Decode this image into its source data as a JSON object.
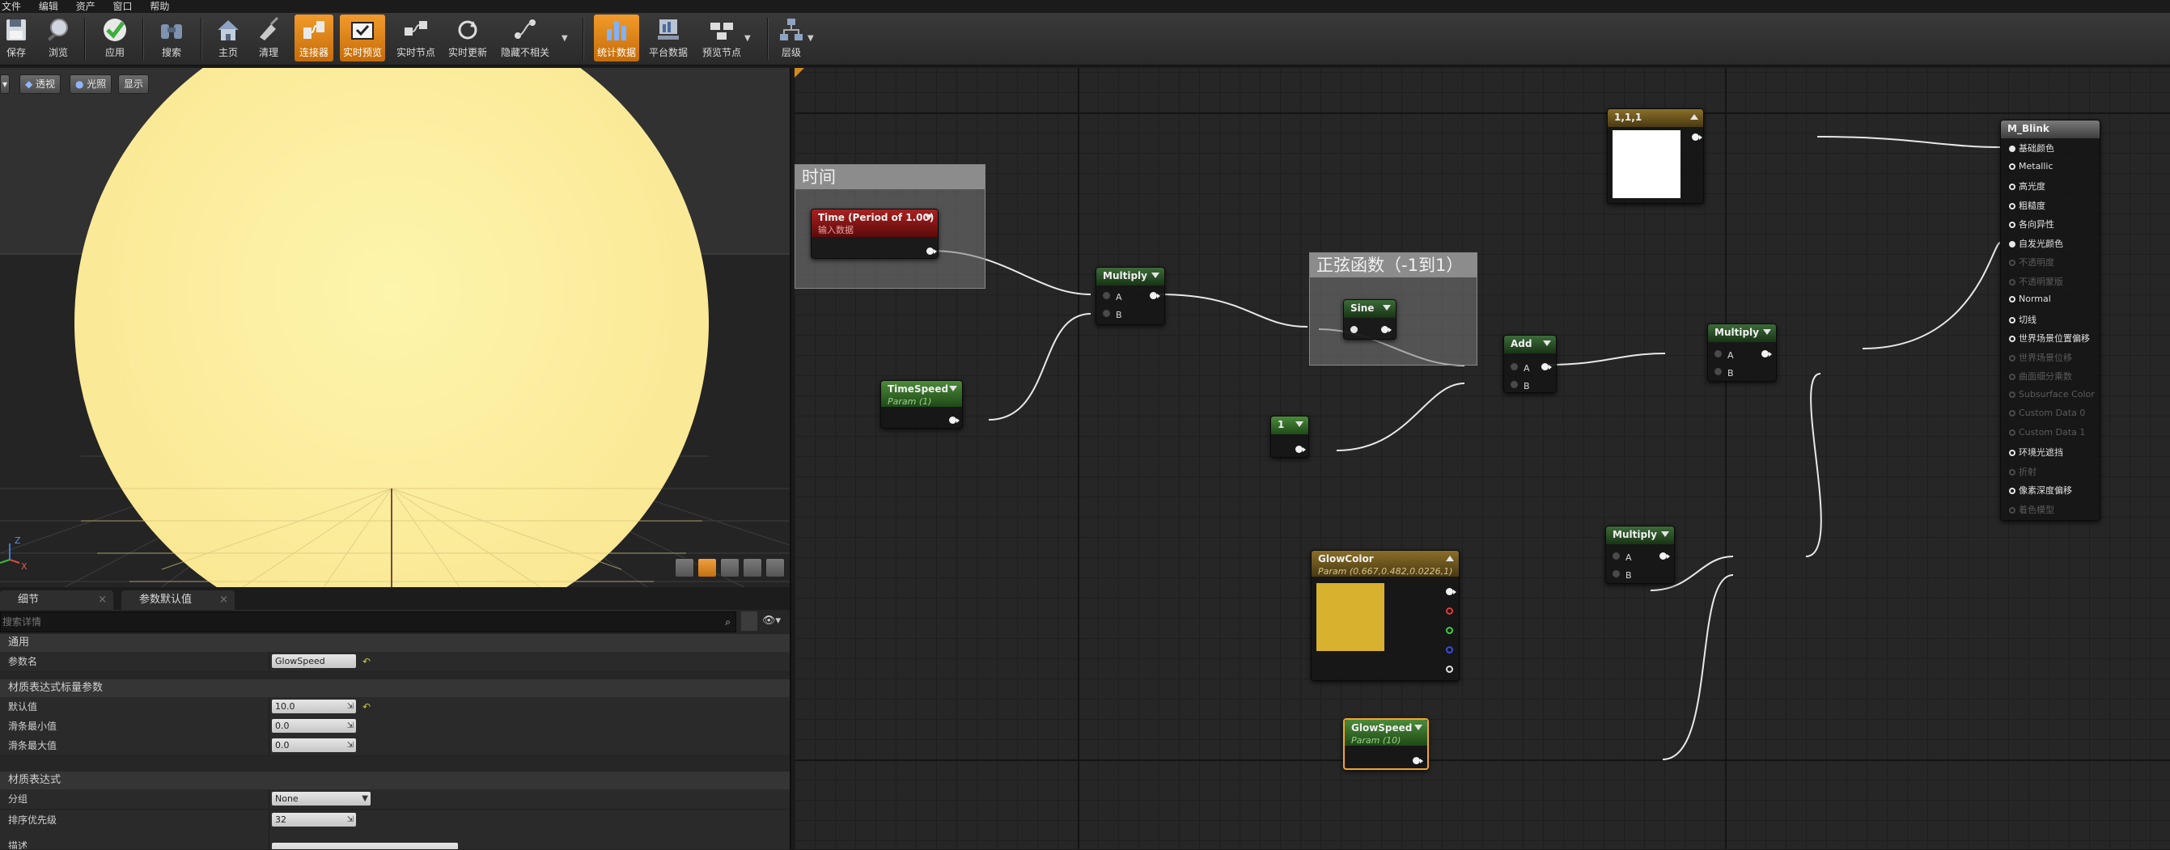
{
  "menu": [
    "文件",
    "编辑",
    "资产",
    "窗口",
    "帮助"
  ],
  "toolbar": {
    "buttons": [
      "保存",
      "浏览",
      "应用",
      "搜索",
      "主页",
      "清理",
      "连接器",
      "实时预览",
      "实时节点",
      "实时更新",
      "隐藏不相关",
      "统计数据",
      "平台数据",
      "预览节点",
      "层级"
    ],
    "active": [
      "连接器",
      "实时预览",
      "统计数据"
    ]
  },
  "viewport": {
    "buttons": [
      "透视",
      "光照",
      "显示"
    ],
    "axis": {
      "z": "Z",
      "x": "X"
    }
  },
  "details": {
    "tabs": [
      "细节",
      "参数默认值"
    ],
    "search_placeholder": "搜索详情",
    "categories": {
      "general": "通用",
      "scalar": "材质表达式标量参数",
      "expression": "材质表达式"
    },
    "props": {
      "param_name": {
        "label": "参数名",
        "value": "GlowSpeed"
      },
      "default": {
        "label": "默认值",
        "value": "10.0"
      },
      "slider_min": {
        "label": "滑条最小值",
        "value": "0.0"
      },
      "slider_max": {
        "label": "滑条最大值",
        "value": "0.0"
      },
      "group": {
        "label": "分组",
        "value": "None"
      },
      "sort": {
        "label": "排序优先级",
        "value": "32"
      },
      "desc": {
        "label": "描述"
      }
    }
  },
  "graph": {
    "comments": {
      "time": "时间",
      "sine": "正弦函数（-1到1）"
    },
    "nodes": {
      "time": {
        "title": "Time (Period of 1.00)",
        "sub": "输入数据"
      },
      "timespeed": {
        "title": "TimeSpeed",
        "sub": "Param (1)"
      },
      "multiply1": {
        "title": "Multiply"
      },
      "sine": {
        "title": "Sine"
      },
      "add": {
        "title": "Add"
      },
      "one": {
        "title": "1"
      },
      "multiply2": {
        "title": "Multiply"
      },
      "multiply3": {
        "title": "Multiply"
      },
      "glowcolor": {
        "title": "GlowColor",
        "sub": "Param (0.667,0.482,0.0226,1)",
        "swatch": "#d8b22f"
      },
      "glowspeed": {
        "title": "GlowSpeed",
        "sub": "Param (10)"
      },
      "white": {
        "title": "1,1,1"
      }
    },
    "pins": {
      "a": "A",
      "b": "B"
    },
    "material": {
      "title": "M_Blink",
      "inputs": [
        {
          "label": "基础颜色",
          "state": "con"
        },
        {
          "label": "Metallic",
          "state": "on"
        },
        {
          "label": "高光度",
          "state": "on"
        },
        {
          "label": "粗糙度",
          "state": "on"
        },
        {
          "label": "各向异性",
          "state": "on"
        },
        {
          "label": "自发光颜色",
          "state": "con"
        },
        {
          "label": "不透明度",
          "state": "off"
        },
        {
          "label": "不透明蒙版",
          "state": "off"
        },
        {
          "label": "Normal",
          "state": "on"
        },
        {
          "label": "切线",
          "state": "on"
        },
        {
          "label": "世界场景位置偏移",
          "state": "on"
        },
        {
          "label": "世界场景位移",
          "state": "off"
        },
        {
          "label": "曲面细分乘数",
          "state": "off"
        },
        {
          "label": "Subsurface Color",
          "state": "off"
        },
        {
          "label": "Custom Data 0",
          "state": "off"
        },
        {
          "label": "Custom Data 1",
          "state": "off"
        },
        {
          "label": "环境光遮挡",
          "state": "on"
        },
        {
          "label": "折射",
          "state": "off"
        },
        {
          "label": "像素深度偏移",
          "state": "on"
        },
        {
          "label": "着色模型",
          "state": "off"
        }
      ]
    }
  }
}
